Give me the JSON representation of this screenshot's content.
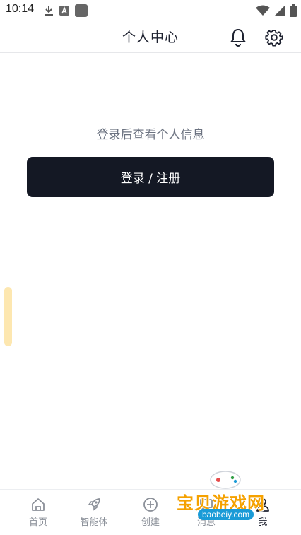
{
  "status_bar": {
    "time": "10:14",
    "icons_left": [
      "download-icon",
      "font-icon",
      "square-icon"
    ],
    "icons_right": [
      "wifi-icon",
      "signal-icon",
      "battery-icon"
    ]
  },
  "header": {
    "title": "个人中心",
    "icons": [
      "bell-icon",
      "gear-icon"
    ]
  },
  "main": {
    "prompt": "登录后查看个人信息",
    "login_button": "登录 / 注册",
    "button_color": "#141824"
  },
  "bottom_nav": {
    "items": [
      {
        "label": "首页",
        "icon": "home-icon"
      },
      {
        "label": "智能体",
        "icon": "rocket-icon"
      },
      {
        "label": "创建",
        "icon": "plus-circle-icon"
      },
      {
        "label": "消息",
        "icon": "message-icon"
      },
      {
        "label": "我",
        "icon": "user-icon"
      }
    ],
    "active_index": 4
  },
  "watermark": {
    "text": "宝贝游戏网",
    "url": "baobeiy.com"
  }
}
